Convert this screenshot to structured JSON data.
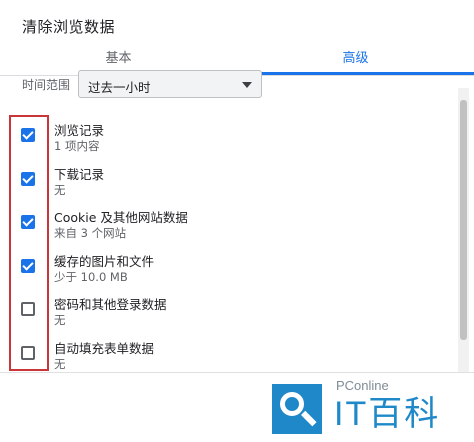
{
  "dialog": {
    "title": "清除浏览数据"
  },
  "tabs": [
    {
      "label": "基本",
      "active": false
    },
    {
      "label": "高级",
      "active": true
    }
  ],
  "time_range": {
    "label": "时间范围",
    "value": "过去一小时"
  },
  "items": [
    {
      "title": "浏览记录",
      "subtitle": "1 项内容",
      "checked": true
    },
    {
      "title": "下载记录",
      "subtitle": "无",
      "checked": true
    },
    {
      "title": "Cookie 及其他网站数据",
      "subtitle": "来自 3 个网站",
      "checked": true
    },
    {
      "title": "缓存的图片和文件",
      "subtitle": "少于 10.0 MB",
      "checked": true
    },
    {
      "title": "密码和其他登录数据",
      "subtitle": "无",
      "checked": false
    },
    {
      "title": "自动填充表单数据",
      "subtitle": "无",
      "checked": false
    }
  ],
  "watermark": {
    "brand": "PConline",
    "text": "IT百科"
  },
  "colors": {
    "accent": "#1a73e8",
    "highlight": "#c8363a",
    "watermark": "#1e88c9"
  }
}
